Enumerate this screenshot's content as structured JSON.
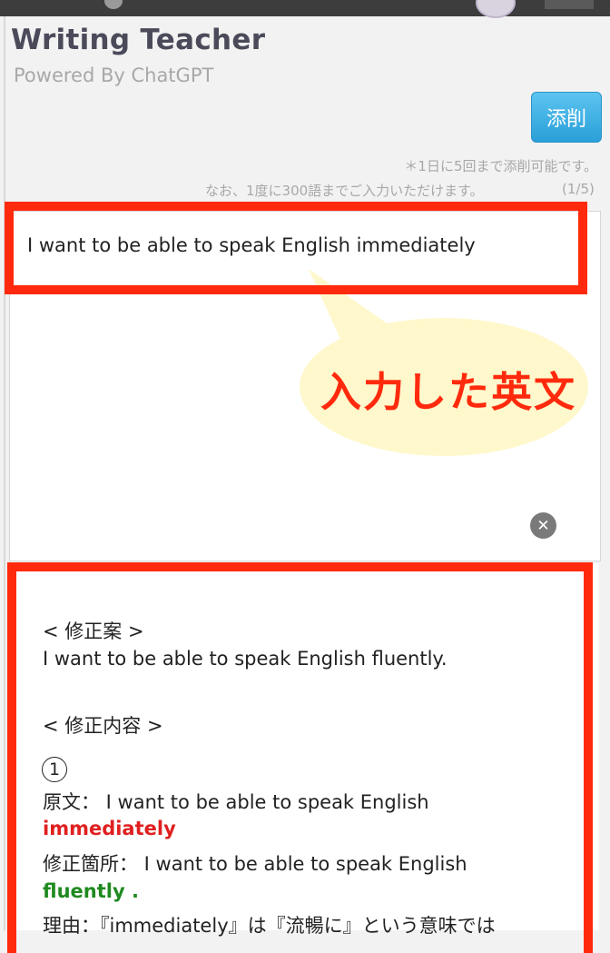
{
  "header": {
    "title": "Writing Teacher",
    "subtitle": "Powered By ChatGPT"
  },
  "toolbar": {
    "correct_label": "添削"
  },
  "notes": {
    "limit_per_day": "＊1日に5回まで添削可能です。",
    "word_limit": "なお、1度に300語までご入力いただけます。",
    "usage_counter": "(1/5)"
  },
  "input": {
    "value": "I want to be able to speak English immediately",
    "clear_icon": "close-circle-icon"
  },
  "annotation": {
    "label": "入力した英文"
  },
  "output": {
    "suggestion_heading": "< 修正案 >",
    "suggestion_text": "I want to be able to speak English fluently.",
    "details_heading": "< 修正内容 >",
    "item_number": "1",
    "original_label": "原文： I want to be able to speak English",
    "original_highlight": "immediately",
    "corrected_label": "修正箇所： I want to be able to speak English",
    "corrected_highlight": "fluently .",
    "reason_text": "理由：『immediately』は『流暢に』という意味では"
  },
  "colors": {
    "highlight_frame": "#ff2a0d",
    "button_blue": "#2a9fd8",
    "error_red": "#e02020",
    "fix_green": "#1f8a1f",
    "bubble_fill": "#fff8cc"
  }
}
